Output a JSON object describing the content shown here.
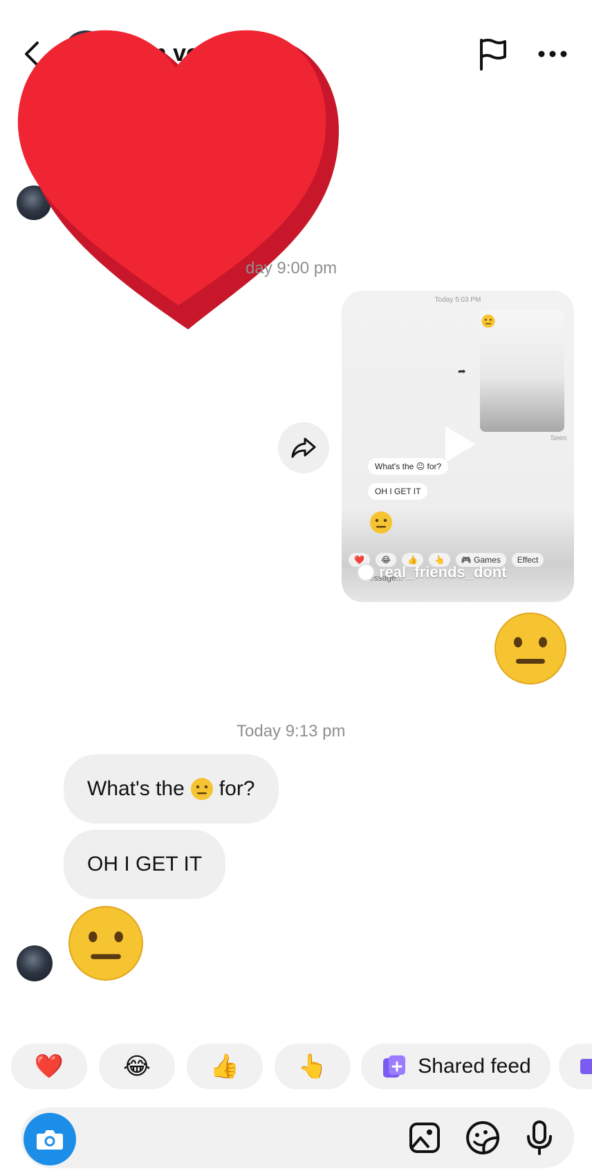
{
  "header": {
    "title": "ula-m version)",
    "back_icon": "chevron-left-icon",
    "flag_icon": "flag-icon",
    "more_icon": "more-horizontal-icon"
  },
  "overlay": {
    "icon": "red-heart-sticker",
    "color": "#e7232f"
  },
  "messages": {
    "timestamp_1": "day 9:00 pm",
    "shared_video": {
      "time": "Today 5:03 PM",
      "bubble_1": "What's the 😐 for?",
      "bubble_2": "OH I GET IT",
      "reactions": [
        "❤️",
        "😂",
        "👍",
        "👆",
        "🎮 Games",
        "Effect"
      ],
      "seen": "Seen",
      "username": "real_friends_dont",
      "composer_hint": "Message..."
    },
    "timestamp_2": "Today 9:13 pm",
    "bubble_1_prefix": "What's the",
    "bubble_1_suffix": "for?",
    "bubble_2": "OH I GET IT"
  },
  "quick_reactions": {
    "heart": "❤️",
    "laugh": "😂",
    "thumbs_up": "👍",
    "point_up": "👆",
    "shared_feed": "Shared feed"
  },
  "composer": {
    "camera_icon": "camera-icon",
    "gallery_icon": "gallery-icon",
    "sticker_icon": "sticker-icon",
    "mic_icon": "microphone-icon",
    "accent": "#1d8ee8"
  }
}
